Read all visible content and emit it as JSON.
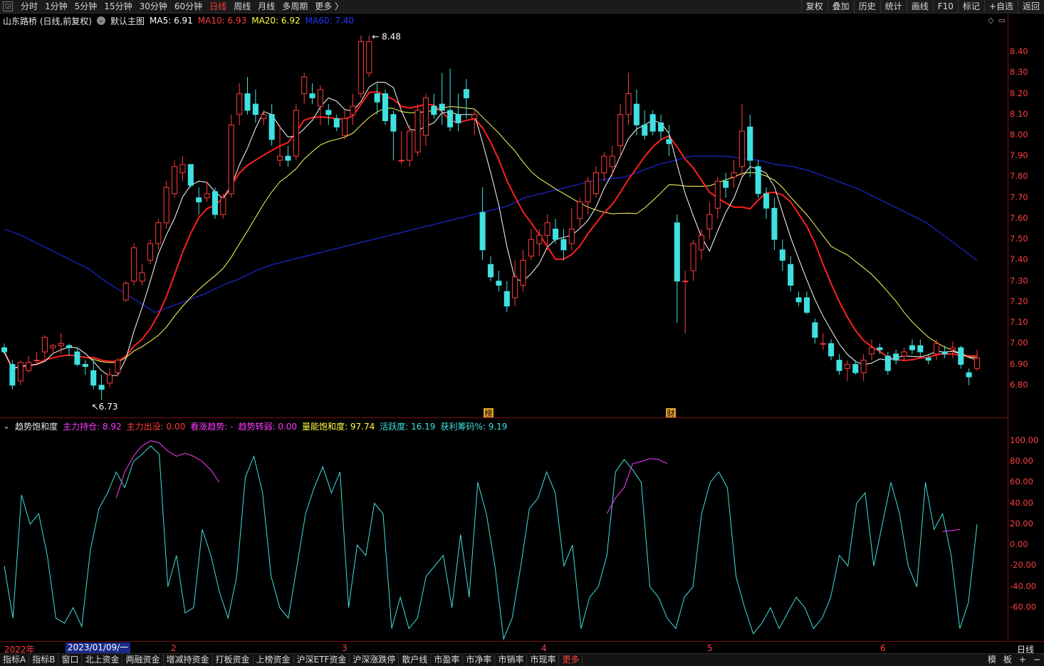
{
  "topbar": {
    "tabs": [
      "分时",
      "1分钟",
      "5分钟",
      "15分钟",
      "30分钟",
      "60分钟",
      "日线",
      "周线",
      "月线",
      "多周期",
      "更多 〉"
    ],
    "active_tab": "日线",
    "tools": [
      "复权",
      "叠加",
      "历史",
      "统计",
      "画线",
      "F10",
      "标记",
      "+自选",
      "返回"
    ]
  },
  "legend": {
    "stock": "山东路桥 (日线,前复权)",
    "template": "默认主图",
    "ma5": "MA5: 6.91",
    "ma10": "MA10: 6.93",
    "ma20": "MA20: 6.92",
    "ma60": "MA60: 7.40"
  },
  "annotations": {
    "high": "8.48",
    "low": "6.73",
    "mark1": "榜",
    "mark2": "财"
  },
  "price_axis": [
    "8.40",
    "8.30",
    "8.20",
    "8.10",
    "8.00",
    "7.90",
    "7.80",
    "7.70",
    "7.60",
    "7.50",
    "7.40",
    "7.30",
    "7.20",
    "7.10",
    "7.00",
    "6.90",
    "6.80"
  ],
  "indicator": {
    "name": "趋势饱和度",
    "items": [
      {
        "label": "主力持仓: 8.92",
        "color": "#ff3bff"
      },
      {
        "label": "主力出没: 0.00",
        "color": "#ff3b3b"
      },
      {
        "label": "看涨趋势: -",
        "color": "#ff3bff"
      },
      {
        "label": "趋势转弱: 0.00",
        "color": "#ff3bff"
      },
      {
        "label": "量能饱和度: 97.74",
        "color": "#ffff40"
      },
      {
        "label": "活跃度: 16.19",
        "color": "#40e0e0"
      },
      {
        "label": "获利筹码%: 9.19",
        "color": "#40e0e0"
      }
    ],
    "axis": [
      "100.00",
      "80.00",
      "60.00",
      "40.00",
      "20.00",
      "0.00",
      "-20.00",
      "-40.00",
      "-60.00"
    ]
  },
  "dates": {
    "year": "2022年",
    "selected": "2023/01/09/一",
    "months": [
      "2",
      "3",
      "4",
      "5",
      "6"
    ],
    "period": "日线"
  },
  "bottombar": {
    "tabs": [
      "指标A",
      "指标B",
      "窗口",
      "北上资金",
      "两融资金",
      "增减持资金",
      "打板资金",
      "上榜资金",
      "沪深ETF资金",
      "沪深涨跌停",
      "散户线",
      "市盈率",
      "市净率",
      "市销率",
      "市现率",
      "更多"
    ],
    "right": [
      "模",
      "板",
      "+",
      "−"
    ]
  },
  "chart_data": {
    "type": "candlestick",
    "ohlc": [
      [
        6.98,
        7.0,
        6.95,
        6.96
      ],
      [
        6.9,
        6.92,
        6.78,
        6.8
      ],
      [
        6.82,
        6.92,
        6.8,
        6.91
      ],
      [
        6.87,
        6.94,
        6.86,
        6.91
      ],
      [
        6.92,
        6.96,
        6.9,
        6.92
      ],
      [
        6.96,
        7.04,
        6.93,
        7.03
      ],
      [
        6.98,
        7.0,
        6.95,
        6.99
      ],
      [
        6.99,
        7.05,
        6.95,
        7.0
      ],
      [
        6.99,
        7.0,
        6.94,
        6.98
      ],
      [
        6.96,
        6.98,
        6.89,
        6.9
      ],
      [
        6.9,
        6.92,
        6.85,
        6.89
      ],
      [
        6.87,
        6.92,
        6.78,
        6.8
      ],
      [
        6.8,
        6.85,
        6.73,
        6.78
      ],
      [
        6.81,
        6.88,
        6.79,
        6.85
      ],
      [
        6.86,
        6.93,
        6.84,
        6.92
      ],
      [
        7.21,
        7.3,
        7.2,
        7.29
      ],
      [
        7.3,
        7.48,
        7.28,
        7.46
      ],
      [
        7.3,
        7.38,
        7.28,
        7.34
      ],
      [
        7.4,
        7.5,
        7.38,
        7.48
      ],
      [
        7.48,
        7.6,
        7.45,
        7.58
      ],
      [
        7.58,
        7.78,
        7.55,
        7.75
      ],
      [
        7.72,
        7.88,
        7.7,
        7.85
      ],
      [
        7.82,
        7.9,
        7.78,
        7.86
      ],
      [
        7.86,
        7.85,
        7.75,
        7.76
      ],
      [
        7.7,
        7.75,
        7.62,
        7.68
      ],
      [
        7.7,
        7.78,
        7.68,
        7.72
      ],
      [
        7.73,
        7.75,
        7.6,
        7.62
      ],
      [
        7.62,
        7.72,
        7.6,
        7.7
      ],
      [
        7.72,
        8.1,
        7.7,
        8.05
      ],
      [
        8.1,
        8.25,
        8.05,
        8.2
      ],
      [
        8.2,
        8.28,
        8.1,
        8.12
      ],
      [
        8.15,
        8.22,
        8.06,
        8.1
      ],
      [
        8.08,
        8.12,
        8.05,
        8.1
      ],
      [
        8.1,
        8.15,
        7.95,
        7.98
      ],
      [
        7.88,
        8.05,
        7.85,
        7.9
      ],
      [
        7.9,
        7.95,
        7.85,
        7.88
      ],
      [
        7.9,
        8.15,
        7.88,
        8.12
      ],
      [
        8.2,
        8.3,
        8.15,
        8.28
      ],
      [
        8.2,
        8.25,
        8.15,
        8.18
      ],
      [
        8.14,
        8.24,
        8.05,
        8.22
      ],
      [
        8.12,
        8.15,
        8.05,
        8.1
      ],
      [
        8.08,
        8.1,
        8.02,
        8.04
      ],
      [
        8.0,
        8.12,
        7.98,
        8.08
      ],
      [
        8.1,
        8.2,
        8.05,
        8.14
      ],
      [
        8.2,
        8.48,
        8.18,
        8.45
      ],
      [
        8.3,
        8.48,
        8.28,
        8.45
      ],
      [
        8.2,
        8.25,
        8.1,
        8.16
      ],
      [
        8.2,
        8.22,
        8.05,
        8.07
      ],
      [
        8.1,
        8.12,
        7.88,
        8.02
      ],
      [
        7.88,
        8.02,
        7.86,
        7.88
      ],
      [
        7.88,
        8.05,
        7.85,
        8.02
      ],
      [
        7.92,
        8.15,
        7.9,
        8.12
      ],
      [
        8.0,
        8.2,
        7.95,
        8.18
      ],
      [
        8.14,
        8.2,
        8.08,
        8.1
      ],
      [
        8.15,
        8.3,
        8.05,
        8.12
      ],
      [
        8.12,
        8.32,
        8.02,
        8.04
      ],
      [
        8.1,
        8.2,
        8.02,
        8.06
      ],
      [
        8.22,
        8.27,
        8.08,
        8.18
      ],
      [
        8.08,
        8.12,
        8.0,
        8.1
      ],
      [
        7.63,
        7.75,
        7.4,
        7.45
      ],
      [
        7.38,
        7.42,
        7.3,
        7.32
      ],
      [
        7.3,
        7.35,
        7.25,
        7.28
      ],
      [
        7.25,
        7.3,
        7.15,
        7.18
      ],
      [
        7.22,
        7.4,
        7.18,
        7.32
      ],
      [
        7.28,
        7.45,
        7.25,
        7.4
      ],
      [
        7.42,
        7.55,
        7.4,
        7.5
      ],
      [
        7.48,
        7.55,
        7.42,
        7.52
      ],
      [
        7.52,
        7.62,
        7.45,
        7.58
      ],
      [
        7.55,
        7.6,
        7.48,
        7.5
      ],
      [
        7.5,
        7.55,
        7.4,
        7.45
      ],
      [
        7.48,
        7.65,
        7.45,
        7.55
      ],
      [
        7.6,
        7.7,
        7.55,
        7.68
      ],
      [
        7.68,
        7.8,
        7.62,
        7.78
      ],
      [
        7.72,
        7.85,
        7.7,
        7.82
      ],
      [
        7.82,
        7.92,
        7.78,
        7.9
      ],
      [
        7.85,
        7.95,
        7.8,
        7.9
      ],
      [
        7.95,
        8.15,
        7.9,
        8.1
      ],
      [
        8.1,
        8.3,
        8.05,
        8.2
      ],
      [
        8.15,
        8.22,
        8.0,
        8.05
      ],
      [
        8.05,
        8.12,
        7.98,
        8.0
      ],
      [
        8.1,
        8.12,
        8.0,
        8.02
      ],
      [
        8.06,
        8.1,
        7.98,
        8.02
      ],
      [
        7.98,
        8.05,
        7.9,
        7.96
      ],
      [
        7.58,
        7.62,
        7.1,
        7.3
      ],
      [
        7.3,
        7.35,
        7.05,
        7.3
      ],
      [
        7.35,
        7.5,
        7.3,
        7.48
      ],
      [
        7.45,
        7.55,
        7.4,
        7.52
      ],
      [
        7.55,
        7.68,
        7.5,
        7.62
      ],
      [
        7.65,
        7.8,
        7.6,
        7.78
      ],
      [
        7.78,
        7.82,
        7.7,
        7.75
      ],
      [
        7.8,
        7.88,
        7.75,
        7.82
      ],
      [
        7.85,
        8.15,
        7.8,
        8.02
      ],
      [
        8.04,
        8.1,
        7.8,
        7.88
      ],
      [
        7.85,
        7.88,
        7.7,
        7.72
      ],
      [
        7.72,
        7.75,
        7.6,
        7.65
      ],
      [
        7.65,
        7.7,
        7.45,
        7.5
      ],
      [
        7.45,
        7.5,
        7.35,
        7.4
      ],
      [
        7.38,
        7.42,
        7.25,
        7.28
      ],
      [
        7.22,
        7.25,
        7.18,
        7.2
      ],
      [
        7.22,
        7.25,
        7.14,
        7.15
      ],
      [
        7.1,
        7.12,
        7.0,
        7.03
      ],
      [
        7.0,
        7.05,
        6.97,
        7.0
      ],
      [
        7.0,
        7.02,
        6.92,
        6.94
      ],
      [
        6.92,
        6.95,
        6.85,
        6.87
      ],
      [
        6.88,
        6.92,
        6.82,
        6.9
      ],
      [
        6.9,
        6.92,
        6.85,
        6.86
      ],
      [
        6.86,
        6.95,
        6.82,
        6.92
      ],
      [
        6.95,
        7.02,
        6.92,
        6.98
      ],
      [
        6.98,
        7.0,
        6.95,
        6.97
      ],
      [
        6.94,
        6.96,
        6.85,
        6.87
      ],
      [
        6.95,
        6.97,
        6.9,
        6.92
      ],
      [
        6.94,
        6.98,
        6.92,
        6.96
      ],
      [
        6.99,
        7.02,
        6.95,
        6.97
      ],
      [
        6.99,
        7.02,
        6.94,
        6.96
      ],
      [
        6.93,
        6.95,
        6.9,
        6.92
      ],
      [
        6.95,
        7.02,
        6.92,
        7.0
      ],
      [
        6.96,
        6.99,
        6.93,
        6.95
      ],
      [
        6.97,
        7.01,
        6.93,
        6.98
      ],
      [
        6.98,
        6.99,
        6.88,
        6.9
      ],
      [
        6.86,
        6.88,
        6.8,
        6.84
      ],
      [
        6.88,
        6.97,
        6.87,
        6.93
      ]
    ],
    "ma5_label": "MA5",
    "ma10_label": "MA10",
    "ma20_label": "MA20",
    "ma60_label": "MA60",
    "ymin": 6.7,
    "ymax": 8.52,
    "colors": {
      "up": "#ff3b3b",
      "down": "#40e0e0",
      "ma5": "#ffffff",
      "ma10": "#ff2020",
      "ma20": "#ffff60",
      "ma60": "#1a28d8"
    },
    "ma60": [
      7.55,
      7.52,
      7.48,
      7.44,
      7.4,
      7.36,
      7.3,
      7.25,
      7.2,
      7.15,
      7.18,
      7.21,
      7.24,
      7.28,
      7.31,
      7.35,
      7.38,
      7.4,
      7.42,
      7.44,
      7.46,
      7.48,
      7.5,
      7.52,
      7.54,
      7.56,
      7.58,
      7.6,
      7.62,
      7.64,
      7.66,
      7.7,
      7.72,
      7.74,
      7.76,
      7.78,
      7.79,
      7.8,
      7.83,
      7.86,
      7.88,
      7.9,
      7.9,
      7.9,
      7.89,
      7.88,
      7.86,
      7.85,
      7.83,
      7.8,
      7.77,
      7.74,
      7.7,
      7.66,
      7.62,
      7.58,
      7.52,
      7.46,
      7.4
    ],
    "ma60_from": 0,
    "oscillator": {
      "ymin": -92,
      "ymax": 110,
      "cyan": [
        -20,
        -70,
        48,
        20,
        30,
        -10,
        -70,
        -75,
        -60,
        -78,
        -5,
        35,
        50,
        70,
        55,
        80,
        87,
        95,
        87,
        -40,
        -10,
        -65,
        -60,
        15,
        -10,
        -45,
        -70,
        -30,
        65,
        85,
        50,
        -30,
        -60,
        -70,
        -20,
        30,
        55,
        75,
        50,
        70,
        -60,
        0,
        -10,
        40,
        30,
        -80,
        -50,
        -80,
        -70,
        -30,
        -20,
        -10,
        -60,
        10,
        -50,
        60,
        30,
        -20,
        -90,
        -70,
        -20,
        35,
        45,
        70,
        50,
        -20,
        0,
        -80,
        -50,
        -40,
        -10,
        70,
        82,
        72,
        60,
        -40,
        -50,
        -70,
        -80,
        -50,
        -40,
        30,
        60,
        70,
        55,
        -30,
        -60,
        -85,
        -75,
        -60,
        -80,
        -65,
        -50,
        -60,
        -80,
        -70,
        -50,
        -10,
        -20,
        40,
        50,
        -20,
        20,
        60,
        30,
        -20,
        -40,
        60,
        15,
        30,
        -10,
        -80,
        -55,
        20
      ],
      "magenta": [
        null,
        null,
        null,
        null,
        null,
        null,
        null,
        null,
        null,
        null,
        null,
        null,
        null,
        45,
        70,
        85,
        95,
        100,
        98,
        90,
        85,
        88,
        85,
        80,
        72,
        60,
        null,
        null,
        null,
        null,
        null,
        null,
        null,
        null,
        null,
        null,
        null,
        null,
        null,
        null,
        null,
        null,
        null,
        null,
        null,
        null,
        null,
        null,
        null,
        null,
        null,
        null,
        null,
        null,
        null,
        null,
        null,
        null,
        null,
        null,
        null,
        null,
        null,
        null,
        null,
        null,
        null,
        null,
        null,
        null,
        30,
        45,
        55,
        78,
        80,
        83,
        82,
        78,
        null,
        null,
        null,
        null,
        null,
        null,
        null,
        null,
        null,
        null,
        null,
        null,
        null,
        null,
        null,
        null,
        null,
        null,
        null,
        null,
        null,
        null,
        null,
        null,
        null,
        null,
        null,
        null,
        null,
        null,
        null,
        13,
        14,
        15,
        null,
        null,
        null,
        null
      ]
    }
  }
}
